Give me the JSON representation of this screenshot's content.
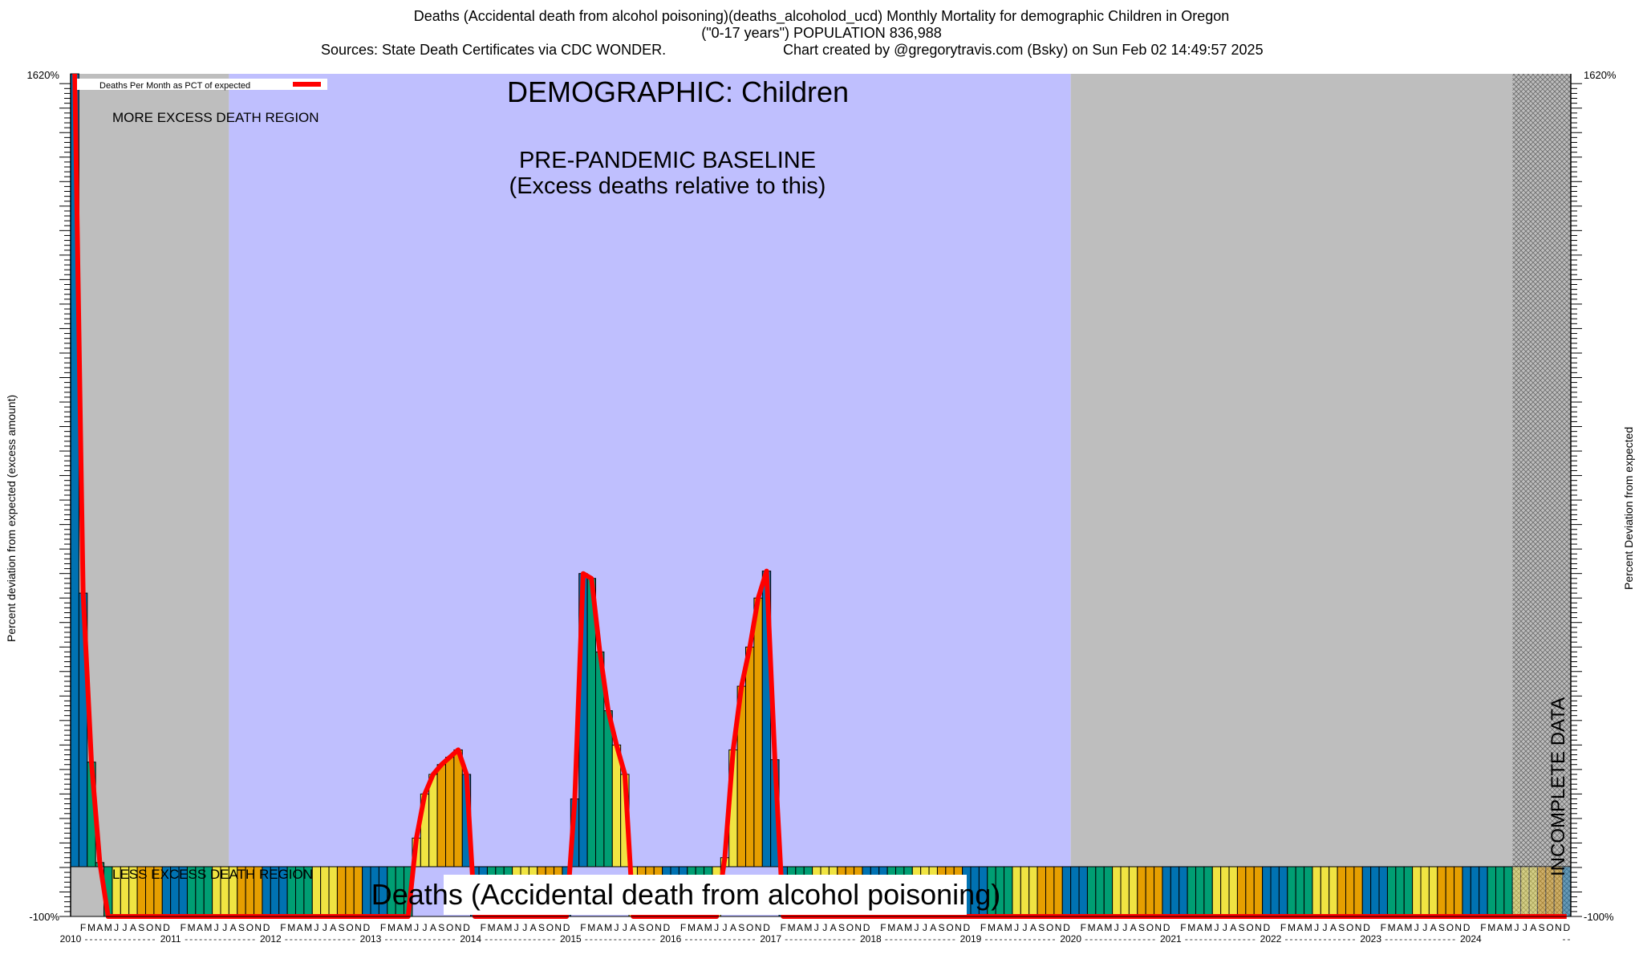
{
  "header": {
    "title_line1": "Deaths (Accidental death from alcohol poisoning)(deaths_alcoholod_ucd) Monthly Mortality for demographic Children in Oregon",
    "title_line2": "(\"0-17 years\") POPULATION 836,988",
    "sources": "Sources: State Death Certificates via CDC WONDER.",
    "credit": "Chart created by @gregorytravis.com (Bsky) on Sun Feb 02 14:49:57 2025"
  },
  "chart_data": {
    "type": "bar",
    "title": "Deaths (Accidental death from alcohol poisoning)(deaths_alcoholod_ucd) Monthly Mortality for demographic Children in Oregon",
    "ylabel_left": "Percent deviation from expected (excess amount)",
    "ylabel_right": "Percent Deviation from expected",
    "ylim": [
      -100,
      1620
    ],
    "y_tick_labels": [
      "-100%",
      "1620%"
    ],
    "years": [
      "2010",
      "2011",
      "2012",
      "2013",
      "2014",
      "2015",
      "2016",
      "2017",
      "2018",
      "2019",
      "2020",
      "2021",
      "2022",
      "2023",
      "2024"
    ],
    "month_letters": [
      "J",
      "F",
      "M",
      "A",
      "M",
      "J",
      "J",
      "A",
      "S",
      "O",
      "N",
      "D"
    ],
    "legend": {
      "line_label": "Deaths Per Month as PCT of expected",
      "line_color": "#ff0000",
      "position": "top-left"
    },
    "annotations": {
      "demographic": "DEMOGRAPHIC: Children",
      "baseline_line1": "PRE-PANDEMIC BASELINE",
      "baseline_line2": "(Excess deaths relative to this)",
      "more_excess": "MORE EXCESS DEATH REGION",
      "less_excess": "LESS EXCESS DEATH REGION",
      "incomplete": "INCOMPLETE DATA",
      "bottom_caption": "Deaths (Accidental death from alcohol poisoning)"
    },
    "regions": [
      {
        "name": "pre-baseline",
        "start_month": 0,
        "end_month": 19,
        "color": "#bebebe"
      },
      {
        "name": "pre-pandemic-baseline",
        "start_month": 19,
        "end_month": 120,
        "color": "#bfbffe"
      },
      {
        "name": "post-baseline",
        "start_month": 120,
        "end_month": 173,
        "color": "#bebebe"
      },
      {
        "name": "incomplete-data",
        "start_month": 173,
        "end_month": 180,
        "color": "#bbbbbb"
      }
    ],
    "season_colors": [
      "#0072b2",
      "#0072b2",
      "#009e73",
      "#009e73",
      "#009e73",
      "#f0e442",
      "#f0e442",
      "#f0e442",
      "#e69f00",
      "#e69f00",
      "#e69f00",
      "#0072b2"
    ],
    "values": [
      1620,
      560,
      215,
      10,
      -100,
      -100,
      -100,
      -100,
      -100,
      -100,
      -100,
      -100,
      -100,
      -100,
      -100,
      -100,
      -100,
      -100,
      -100,
      -100,
      -100,
      -100,
      -100,
      -100,
      -100,
      -100,
      -100,
      -100,
      -100,
      -100,
      -100,
      -100,
      -100,
      -100,
      -100,
      -100,
      -100,
      -100,
      -100,
      -100,
      -100,
      60,
      150,
      190,
      210,
      225,
      240,
      190,
      -100,
      -100,
      -100,
      -100,
      -100,
      -100,
      -100,
      -100,
      -100,
      -100,
      -100,
      -100,
      140,
      600,
      590,
      440,
      320,
      250,
      190,
      -100,
      -100,
      -100,
      -100,
      -100,
      -100,
      -100,
      -100,
      -100,
      -100,
      -100,
      20,
      240,
      370,
      450,
      550,
      605,
      220,
      -100,
      -100,
      -100,
      -100,
      -100,
      -100,
      -100,
      -100,
      -100,
      -100,
      -100,
      -100,
      -100,
      -100,
      -100,
      -100,
      -100,
      -100,
      -100,
      -100,
      -100,
      -100,
      -100,
      -100,
      -100,
      -100,
      -100,
      -100,
      -100,
      -100,
      -100,
      -100,
      -100,
      -100,
      -100,
      -100,
      -100,
      -100,
      -100,
      -100,
      -100,
      -100,
      -100,
      -100,
      -100,
      -100,
      -100,
      -100,
      -100,
      -100,
      -100,
      -100,
      -100,
      -100,
      -100,
      -100,
      -100,
      -100,
      -100,
      -100,
      -100,
      -100,
      -100,
      -100,
      -100,
      -100,
      -100,
      -100,
      -100,
      -100,
      -100,
      -100,
      -100,
      -100,
      -100,
      -100,
      -100,
      -100,
      -100,
      -100,
      -100,
      -100,
      -100,
      -100,
      -100,
      -100,
      -100,
      -100,
      -100,
      -100,
      -100,
      -100,
      -100,
      -100,
      -100
    ],
    "grid": false
  }
}
